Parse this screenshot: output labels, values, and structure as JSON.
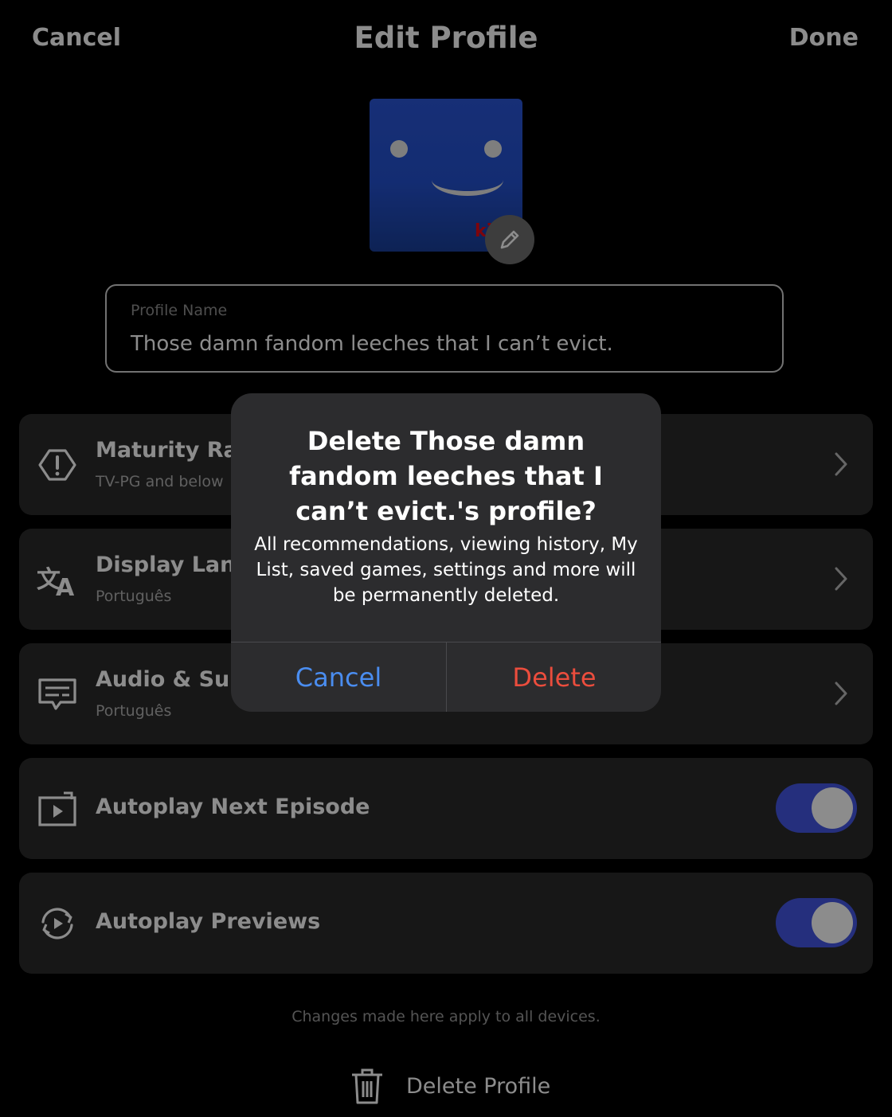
{
  "header": {
    "cancel_label": "Cancel",
    "title": "Edit Profile",
    "done_label": "Done"
  },
  "avatar": {
    "kids_mark": "ki",
    "edit_icon": "pencil-icon"
  },
  "profile_name": {
    "label": "Profile Name",
    "value": "Those damn fandom leeches that I can’t evict."
  },
  "settings": {
    "maturity": {
      "title": "Maturity Rati",
      "subtitle": "TV-PG and below",
      "icon": "alert-octagon-icon"
    },
    "display_language": {
      "title": "Display Lang",
      "subtitle": "Português",
      "icon": "translate-icon"
    },
    "audio_subtitles": {
      "title": "Audio & Subt",
      "subtitle": "Português",
      "icon": "subtitles-icon"
    },
    "autoplay_next": {
      "title": "Autoplay Next Episode",
      "enabled": true,
      "icon": "play-next-icon"
    },
    "autoplay_previews": {
      "title": "Autoplay Previews",
      "enabled": true,
      "icon": "preview-cycle-icon"
    }
  },
  "footer": {
    "note": "Changes made here apply to all devices.",
    "delete_profile_label": "Delete Profile",
    "delete_icon": "trash-icon"
  },
  "dialog": {
    "title": "Delete Those damn fandom leeches that I can’t evict.'s profile?",
    "message": "All recommendations, viewing history, My List, saved games, settings and more will be permanently deleted.",
    "cancel_label": "Cancel",
    "delete_label": "Delete"
  },
  "colors": {
    "toggle_on": "#4457e4",
    "dialog_cancel": "#4a8df0",
    "dialog_delete": "#eb4d3d",
    "avatar_blue": "#2451cf"
  }
}
